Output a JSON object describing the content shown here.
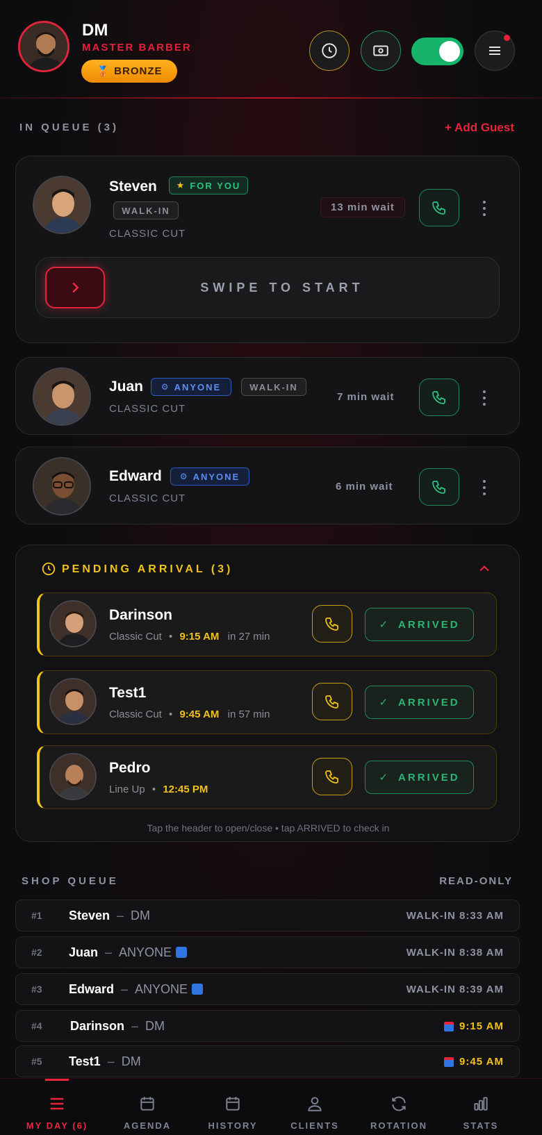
{
  "header": {
    "name": "DM",
    "role": "MASTER BARBER",
    "badge": "BRONZE",
    "badge_emoji": "🥉",
    "buttons": [
      "clock-icon",
      "cash-icon",
      "toggle-on",
      "menu-icon"
    ],
    "status_on": true
  },
  "queue": {
    "title": "IN QUEUE (3)",
    "add_guest": "+ Add Guest",
    "swipe_label": "SWIPE TO START",
    "guests": [
      {
        "name": "Steven",
        "tags": [
          "FOR YOU",
          "WALK-IN"
        ],
        "service": "CLASSIC CUT",
        "wait": "13 min wait"
      },
      {
        "name": "Juan",
        "tags": [
          "ANYONE",
          "WALK-IN"
        ],
        "service": "CLASSIC CUT",
        "wait": "7 min wait"
      },
      {
        "name": "Edward",
        "tags": [
          "ANYONE"
        ],
        "service": "CLASSIC CUT",
        "wait": "6 min wait"
      }
    ]
  },
  "pending": {
    "title": "PENDING ARRIVAL (3)",
    "arrived_label": "ARRIVED",
    "hint": "Tap the header to open/close • tap ARRIVED to check in",
    "items": [
      {
        "name": "Darinson",
        "service": "Classic Cut",
        "time": "9:15 AM",
        "eta": "in 27 min"
      },
      {
        "name": "Test1",
        "service": "Classic Cut",
        "time": "9:45 AM",
        "eta": "in 57 min"
      },
      {
        "name": "Pedro",
        "service": "Line Up",
        "time": "12:45 PM",
        "eta": ""
      }
    ]
  },
  "shop_queue": {
    "title": "SHOP QUEUE",
    "mode": "READ-ONLY",
    "rows": [
      {
        "num": "#1",
        "name": "Steven",
        "who": "DM",
        "right": "WALK-IN 8:33 AM"
      },
      {
        "num": "#2",
        "name": "Juan",
        "who": "ANYONE",
        "right": "WALK-IN 8:38 AM"
      },
      {
        "num": "#3",
        "name": "Edward",
        "who": "ANYONE",
        "right": "WALK-IN 8:39 AM"
      },
      {
        "num": "#4",
        "name": "Darinson",
        "who": "DM",
        "right": "9:15 AM"
      },
      {
        "num": "#5",
        "name": "Test1",
        "who": "DM",
        "right": "9:45 AM"
      }
    ]
  },
  "nav": {
    "items": [
      {
        "label": "MY DAY (6)",
        "icon": "menu-icon",
        "active": true
      },
      {
        "label": "AGENDA",
        "icon": "calendar-icon"
      },
      {
        "label": "HISTORY",
        "icon": "calendar-icon"
      },
      {
        "label": "CLIENTS",
        "icon": "person-icon"
      },
      {
        "label": "ROTATION",
        "icon": "refresh-icon"
      },
      {
        "label": "STATS",
        "icon": "bar-chart-icon"
      }
    ]
  },
  "colors": {
    "accent": "#e8243c",
    "success": "#16b46a",
    "gold": "#f2c21b",
    "info": "#2a5bc0",
    "background": "#0d0d0f"
  }
}
